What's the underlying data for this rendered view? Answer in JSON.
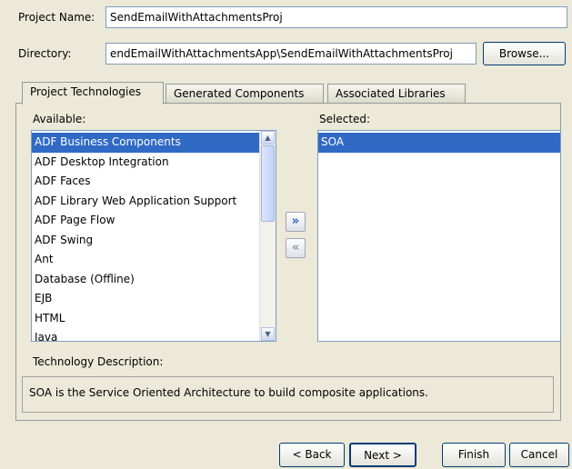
{
  "project": {
    "name_label": "Project Name:",
    "name_value": "SendEmailWithAttachmentsProj",
    "dir_label": "Directory:",
    "dir_value": "endEmailWithAttachmentsApp\\SendEmailWithAttachmentsProj",
    "browse_label": "Browse..."
  },
  "tabs": [
    {
      "label": "Project Technologies",
      "active": true
    },
    {
      "label": "Generated Components",
      "active": false
    },
    {
      "label": "Associated Libraries",
      "active": false
    }
  ],
  "available": {
    "label": "Available:",
    "items": [
      "ADF Business Components",
      "ADF Desktop Integration",
      "ADF Faces",
      "ADF Library Web Application Support",
      "ADF Page Flow",
      "ADF Swing",
      "Ant",
      "Database (Offline)",
      "EJB",
      "HTML",
      "Java"
    ],
    "selected_index": 0
  },
  "selected": {
    "label": "Selected:",
    "items": [
      "SOA"
    ]
  },
  "move_buttons": {
    "add_icon": "»",
    "remove_icon": "«"
  },
  "description": {
    "label": "Technology Description:",
    "text": "SOA is the Service Oriented Architecture to build composite applications."
  },
  "footer": {
    "back_label": "< Back",
    "next_label": "Next >",
    "finish_label": "Finish",
    "cancel_label": "Cancel"
  },
  "icons": {
    "scroll_up": "scroll-up-icon",
    "scroll_down": "scroll-down-icon",
    "add": "double-chevron-right-icon",
    "remove": "double-chevron-left-icon"
  }
}
